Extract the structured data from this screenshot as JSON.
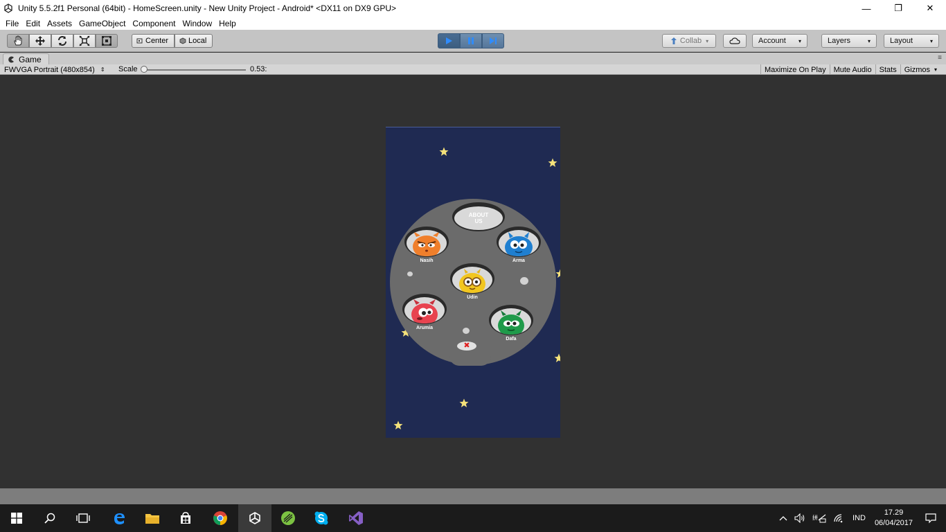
{
  "window": {
    "title": "Unity 5.5.2f1 Personal (64bit) - HomeScreen.unity - New Unity Project - Android* <DX11 on DX9 GPU>",
    "minimize": "—",
    "maximize": "❐",
    "close": "✕"
  },
  "menu": [
    "File",
    "Edit",
    "Assets",
    "GameObject",
    "Component",
    "Window",
    "Help"
  ],
  "toolbar": {
    "pivot_center": "Center",
    "pivot_local": "Local",
    "collab": "Collab",
    "account": "Account",
    "layers": "Layers",
    "layout": "Layout"
  },
  "game_tab": {
    "label": "Game",
    "resolution": "FWVGA Portrait (480x854)",
    "scale_label": "Scale",
    "scale_value": "0.53:",
    "maximize_on_play": "Maximize On Play",
    "mute_audio": "Mute Audio",
    "stats": "Stats",
    "gizmos": "Gizmos"
  },
  "game": {
    "about_label": "ABOUT US",
    "characters": [
      {
        "name": "Nasih",
        "color": "#f07f2b"
      },
      {
        "name": "Arma",
        "color": "#1f7fd0"
      },
      {
        "name": "Udin",
        "color": "#f2c61f"
      },
      {
        "name": "Arumia",
        "color": "#e8434f"
      },
      {
        "name": "Dafa",
        "color": "#1f9a4a"
      }
    ],
    "close_symbol": "✖"
  },
  "taskbar": {
    "language": "IND",
    "time": "17.29",
    "date": "06/04/2017"
  },
  "colors": {
    "space": "#1f2a52",
    "moon": "#6b6b6b",
    "star": "#f4e17a"
  }
}
